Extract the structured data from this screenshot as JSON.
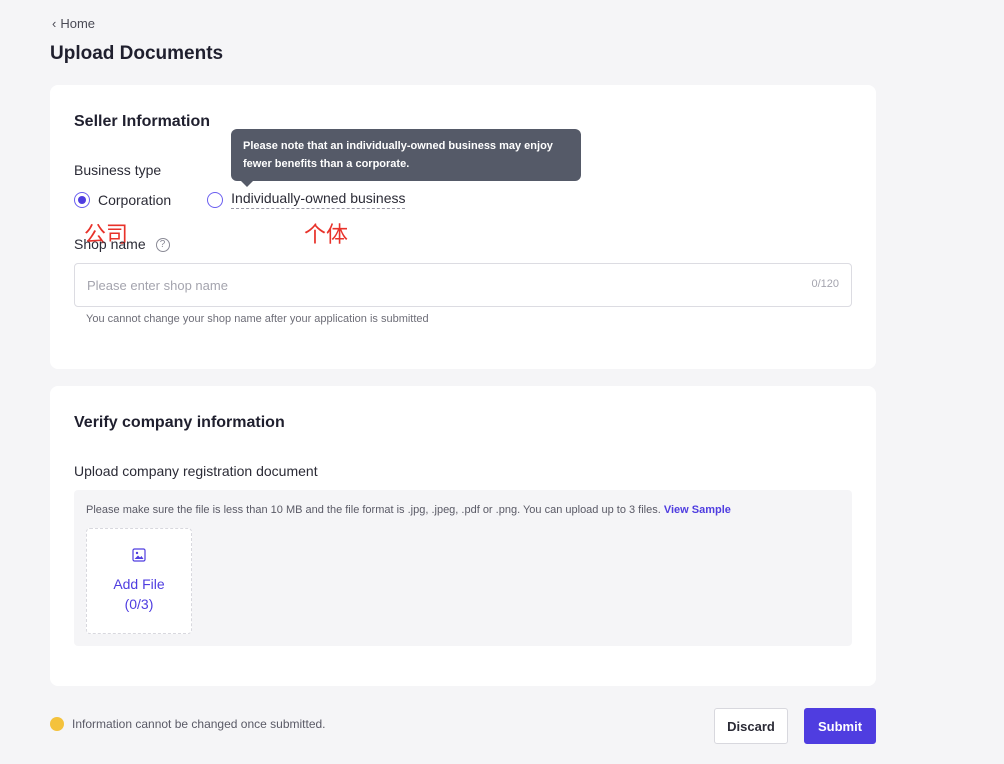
{
  "breadcrumb": {
    "home_label": "Home"
  },
  "page": {
    "title": "Upload Documents"
  },
  "seller_info": {
    "title": "Seller Information",
    "business_type_label": "Business type",
    "options": [
      {
        "label": "Corporation",
        "selected": true
      },
      {
        "label": "Individually-owned business",
        "selected": false
      }
    ],
    "tooltip": "Please note that an individually-owned business may enjoy fewer benefits than a corporate.",
    "annotations": {
      "corporation": "公司",
      "individual": "个体"
    },
    "shop_name_label": "Shop name",
    "shop_name_placeholder": "Please enter shop name",
    "shop_name_value": "",
    "shop_name_counter": "0/120",
    "shop_name_hint": "You cannot change your shop name after your application is submitted"
  },
  "verify": {
    "title": "Verify company information",
    "upload_label": "Upload company registration document",
    "upload_note": "Please make sure the file is less than 10 MB and the file format is .jpg, .jpeg, .pdf or .png. You can upload up to 3 files.",
    "view_sample": "View Sample",
    "add_file_label": "Add File",
    "add_file_count": "(0/3)"
  },
  "footer": {
    "note": "Information cannot be changed once submitted.",
    "discard_label": "Discard",
    "submit_label": "Submit"
  },
  "colors": {
    "accent": "#4f3de0",
    "tooltip_bg": "#555a68",
    "annotation": "#e8322a",
    "warning": "#f4c23c"
  },
  "icons": [
    "chevron-left-icon",
    "help-icon",
    "image-icon",
    "warning-icon"
  ]
}
